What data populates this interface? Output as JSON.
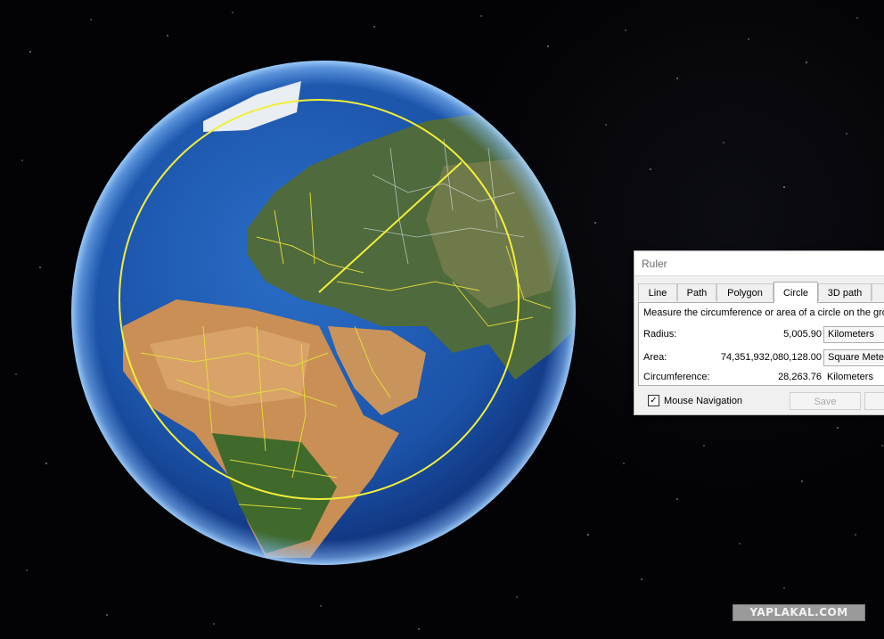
{
  "ruler": {
    "title": "Ruler",
    "tabs": [
      {
        "label": "Line",
        "active": false
      },
      {
        "label": "Path",
        "active": false
      },
      {
        "label": "Polygon",
        "active": false
      },
      {
        "label": "Circle",
        "active": true
      },
      {
        "label": "3D path",
        "active": false
      }
    ],
    "description": "Measure the circumference or area of a circle on the gro",
    "radius": {
      "label": "Radius:",
      "value": "5,005.90",
      "unit": "Kilometers"
    },
    "area": {
      "label": "Area:",
      "value": "74,351,932,080,128.00",
      "unit": "Square Meter"
    },
    "circumference": {
      "label": "Circumference:",
      "value": "28,263.76",
      "unit": "Kilometers"
    },
    "mouse_navigation": {
      "label": "Mouse Navigation",
      "checked": true,
      "mark": "✓"
    },
    "save_label": "Save"
  },
  "watermark": "YAPLAKAL.COM",
  "colors": {
    "measure_circle": "#f2ee3a",
    "borders": "#e8e23a",
    "ocean": "#1f5fb8",
    "space": "#030306"
  }
}
